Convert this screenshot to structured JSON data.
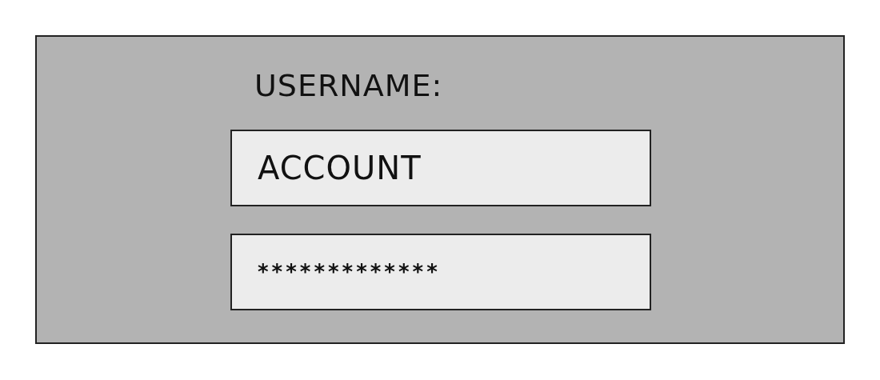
{
  "login_form": {
    "label": "USERNAME:",
    "fields": [
      {
        "kind": "text",
        "value": "ACCOUNT"
      },
      {
        "kind": "password",
        "value": "*************"
      }
    ]
  }
}
